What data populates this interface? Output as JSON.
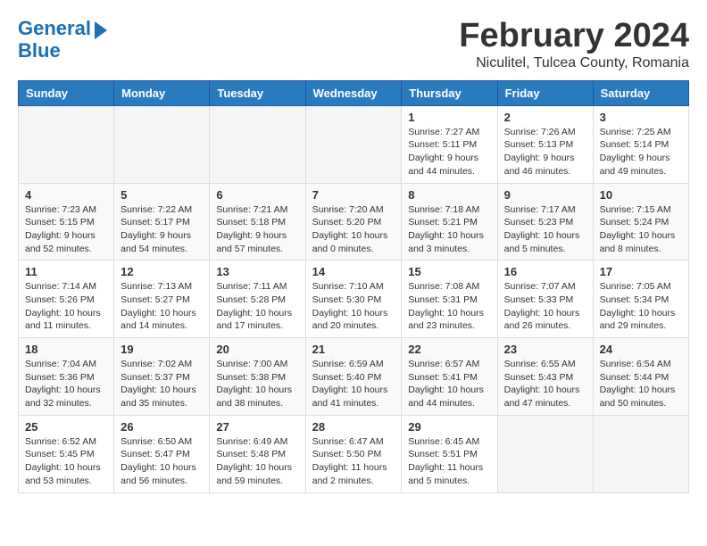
{
  "header": {
    "logo_line1": "General",
    "logo_line2": "Blue",
    "month": "February 2024",
    "location": "Niculitel, Tulcea County, Romania"
  },
  "weekdays": [
    "Sunday",
    "Monday",
    "Tuesday",
    "Wednesday",
    "Thursday",
    "Friday",
    "Saturday"
  ],
  "weeks": [
    [
      {
        "day": "",
        "sunrise": "",
        "sunset": "",
        "daylight": ""
      },
      {
        "day": "",
        "sunrise": "",
        "sunset": "",
        "daylight": ""
      },
      {
        "day": "",
        "sunrise": "",
        "sunset": "",
        "daylight": ""
      },
      {
        "day": "",
        "sunrise": "",
        "sunset": "",
        "daylight": ""
      },
      {
        "day": "1",
        "sunrise": "Sunrise: 7:27 AM",
        "sunset": "Sunset: 5:11 PM",
        "daylight": "Daylight: 9 hours and 44 minutes."
      },
      {
        "day": "2",
        "sunrise": "Sunrise: 7:26 AM",
        "sunset": "Sunset: 5:13 PM",
        "daylight": "Daylight: 9 hours and 46 minutes."
      },
      {
        "day": "3",
        "sunrise": "Sunrise: 7:25 AM",
        "sunset": "Sunset: 5:14 PM",
        "daylight": "Daylight: 9 hours and 49 minutes."
      }
    ],
    [
      {
        "day": "4",
        "sunrise": "Sunrise: 7:23 AM",
        "sunset": "Sunset: 5:15 PM",
        "daylight": "Daylight: 9 hours and 52 minutes."
      },
      {
        "day": "5",
        "sunrise": "Sunrise: 7:22 AM",
        "sunset": "Sunset: 5:17 PM",
        "daylight": "Daylight: 9 hours and 54 minutes."
      },
      {
        "day": "6",
        "sunrise": "Sunrise: 7:21 AM",
        "sunset": "Sunset: 5:18 PM",
        "daylight": "Daylight: 9 hours and 57 minutes."
      },
      {
        "day": "7",
        "sunrise": "Sunrise: 7:20 AM",
        "sunset": "Sunset: 5:20 PM",
        "daylight": "Daylight: 10 hours and 0 minutes."
      },
      {
        "day": "8",
        "sunrise": "Sunrise: 7:18 AM",
        "sunset": "Sunset: 5:21 PM",
        "daylight": "Daylight: 10 hours and 3 minutes."
      },
      {
        "day": "9",
        "sunrise": "Sunrise: 7:17 AM",
        "sunset": "Sunset: 5:23 PM",
        "daylight": "Daylight: 10 hours and 5 minutes."
      },
      {
        "day": "10",
        "sunrise": "Sunrise: 7:15 AM",
        "sunset": "Sunset: 5:24 PM",
        "daylight": "Daylight: 10 hours and 8 minutes."
      }
    ],
    [
      {
        "day": "11",
        "sunrise": "Sunrise: 7:14 AM",
        "sunset": "Sunset: 5:26 PM",
        "daylight": "Daylight: 10 hours and 11 minutes."
      },
      {
        "day": "12",
        "sunrise": "Sunrise: 7:13 AM",
        "sunset": "Sunset: 5:27 PM",
        "daylight": "Daylight: 10 hours and 14 minutes."
      },
      {
        "day": "13",
        "sunrise": "Sunrise: 7:11 AM",
        "sunset": "Sunset: 5:28 PM",
        "daylight": "Daylight: 10 hours and 17 minutes."
      },
      {
        "day": "14",
        "sunrise": "Sunrise: 7:10 AM",
        "sunset": "Sunset: 5:30 PM",
        "daylight": "Daylight: 10 hours and 20 minutes."
      },
      {
        "day": "15",
        "sunrise": "Sunrise: 7:08 AM",
        "sunset": "Sunset: 5:31 PM",
        "daylight": "Daylight: 10 hours and 23 minutes."
      },
      {
        "day": "16",
        "sunrise": "Sunrise: 7:07 AM",
        "sunset": "Sunset: 5:33 PM",
        "daylight": "Daylight: 10 hours and 26 minutes."
      },
      {
        "day": "17",
        "sunrise": "Sunrise: 7:05 AM",
        "sunset": "Sunset: 5:34 PM",
        "daylight": "Daylight: 10 hours and 29 minutes."
      }
    ],
    [
      {
        "day": "18",
        "sunrise": "Sunrise: 7:04 AM",
        "sunset": "Sunset: 5:36 PM",
        "daylight": "Daylight: 10 hours and 32 minutes."
      },
      {
        "day": "19",
        "sunrise": "Sunrise: 7:02 AM",
        "sunset": "Sunset: 5:37 PM",
        "daylight": "Daylight: 10 hours and 35 minutes."
      },
      {
        "day": "20",
        "sunrise": "Sunrise: 7:00 AM",
        "sunset": "Sunset: 5:38 PM",
        "daylight": "Daylight: 10 hours and 38 minutes."
      },
      {
        "day": "21",
        "sunrise": "Sunrise: 6:59 AM",
        "sunset": "Sunset: 5:40 PM",
        "daylight": "Daylight: 10 hours and 41 minutes."
      },
      {
        "day": "22",
        "sunrise": "Sunrise: 6:57 AM",
        "sunset": "Sunset: 5:41 PM",
        "daylight": "Daylight: 10 hours and 44 minutes."
      },
      {
        "day": "23",
        "sunrise": "Sunrise: 6:55 AM",
        "sunset": "Sunset: 5:43 PM",
        "daylight": "Daylight: 10 hours and 47 minutes."
      },
      {
        "day": "24",
        "sunrise": "Sunrise: 6:54 AM",
        "sunset": "Sunset: 5:44 PM",
        "daylight": "Daylight: 10 hours and 50 minutes."
      }
    ],
    [
      {
        "day": "25",
        "sunrise": "Sunrise: 6:52 AM",
        "sunset": "Sunset: 5:45 PM",
        "daylight": "Daylight: 10 hours and 53 minutes."
      },
      {
        "day": "26",
        "sunrise": "Sunrise: 6:50 AM",
        "sunset": "Sunset: 5:47 PM",
        "daylight": "Daylight: 10 hours and 56 minutes."
      },
      {
        "day": "27",
        "sunrise": "Sunrise: 6:49 AM",
        "sunset": "Sunset: 5:48 PM",
        "daylight": "Daylight: 10 hours and 59 minutes."
      },
      {
        "day": "28",
        "sunrise": "Sunrise: 6:47 AM",
        "sunset": "Sunset: 5:50 PM",
        "daylight": "Daylight: 11 hours and 2 minutes."
      },
      {
        "day": "29",
        "sunrise": "Sunrise: 6:45 AM",
        "sunset": "Sunset: 5:51 PM",
        "daylight": "Daylight: 11 hours and 5 minutes."
      },
      {
        "day": "",
        "sunrise": "",
        "sunset": "",
        "daylight": ""
      },
      {
        "day": "",
        "sunrise": "",
        "sunset": "",
        "daylight": ""
      }
    ]
  ]
}
